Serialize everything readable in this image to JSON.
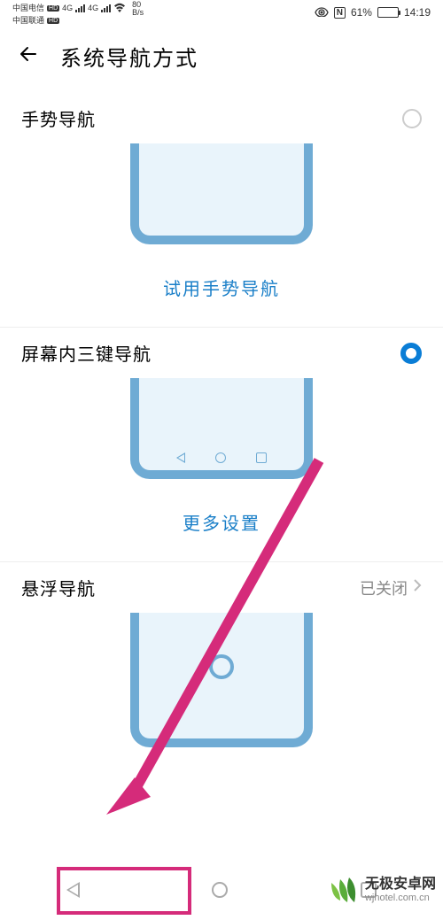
{
  "status": {
    "carrier1": "中国电信",
    "carrier2": "中国联通",
    "netGen": "4G",
    "speed_top": "80",
    "speed_bottom": "B/s",
    "nfc": "N",
    "battery_pct": "61%",
    "time": "14:19"
  },
  "header": {
    "title": "系统导航方式"
  },
  "options": {
    "gesture": {
      "label": "手势导航",
      "link": "试用手势导航"
    },
    "threekey": {
      "label": "屏幕内三键导航",
      "link": "更多设置"
    },
    "floating": {
      "label": "悬浮导航",
      "status": "已关闭"
    }
  },
  "watermark": {
    "title": "无极安卓网",
    "url": "wjhotel.com.cn"
  }
}
